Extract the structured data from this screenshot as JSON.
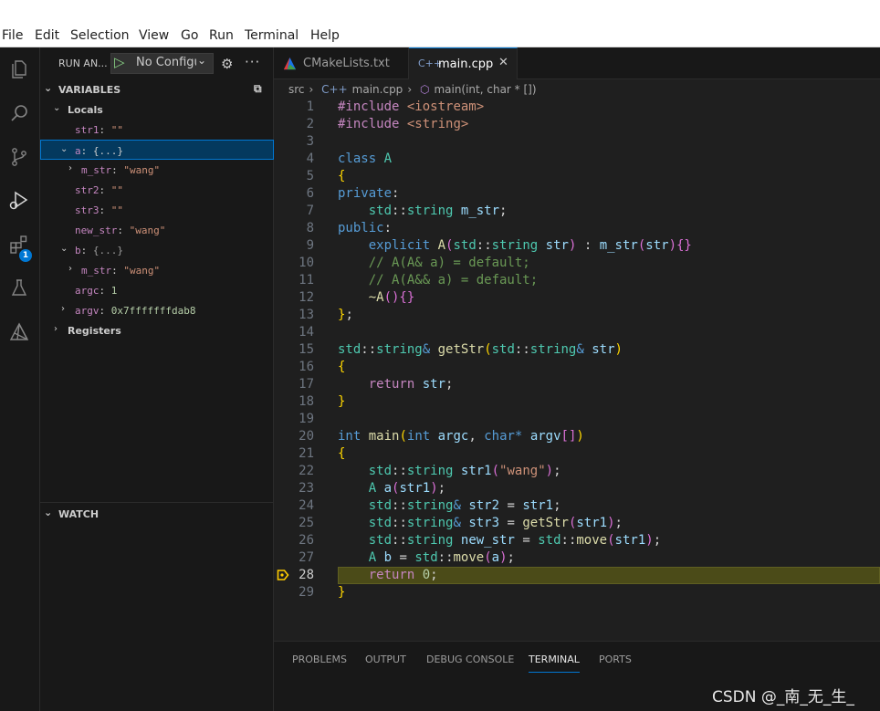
{
  "menu": [
    "File",
    "Edit",
    "Selection",
    "View",
    "Go",
    "Run",
    "Terminal",
    "Help"
  ],
  "activity_icons": [
    "explorer-icon",
    "search-icon",
    "source-control-icon",
    "run-debug-icon",
    "extensions-icon",
    "testing-icon",
    "cmake-icon"
  ],
  "debug_badge": "1",
  "run_bar": {
    "title": "RUN AN...",
    "config": "No Configu",
    "play_icon": "play-icon",
    "gear_icon": "gear-icon",
    "more_icon": "more-icon"
  },
  "variables": {
    "header": "VARIABLES",
    "locals_label": "Locals",
    "registers_label": "Registers",
    "rows": [
      {
        "name": "str1",
        "value": "\"\"",
        "kind": "str"
      },
      {
        "name": "a",
        "value": "{...}",
        "kind": "obj"
      },
      {
        "name": "m_str",
        "value": "\"wang\"",
        "kind": "str"
      },
      {
        "name": "str2",
        "value": "\"\"",
        "kind": "str"
      },
      {
        "name": "str3",
        "value": "\"\"",
        "kind": "str"
      },
      {
        "name": "new_str",
        "value": "\"wang\"",
        "kind": "str"
      },
      {
        "name": "b",
        "value": "{...}",
        "kind": "obj"
      },
      {
        "name": "m_str",
        "value": "\"wang\"",
        "kind": "str"
      },
      {
        "name": "argc",
        "value": "1",
        "kind": "num"
      },
      {
        "name": "argv",
        "value": "0x7fffffffdab8",
        "kind": "num"
      }
    ]
  },
  "watch": {
    "header": "WATCH"
  },
  "tabs": [
    {
      "label": "CMakeLists.txt",
      "active": false
    },
    {
      "label": "main.cpp",
      "active": true
    }
  ],
  "breadcrumb": {
    "folder": "src",
    "file": "main.cpp",
    "symbol": "main(int, char * [])"
  },
  "code": {
    "current_line": 28,
    "line_numbers": [
      "1",
      "2",
      "3",
      "4",
      "5",
      "6",
      "7",
      "8",
      "9",
      "10",
      "11",
      "12",
      "13",
      "14",
      "15",
      "16",
      "17",
      "18",
      "19",
      "20",
      "21",
      "22",
      "23",
      "24",
      "25",
      "26",
      "27",
      "28",
      "29"
    ]
  },
  "panel": {
    "tabs": [
      "PROBLEMS",
      "OUTPUT",
      "DEBUG CONSOLE",
      "TERMINAL",
      "PORTS"
    ],
    "active": "TERMINAL"
  },
  "watermark": "CSDN @_南_无_生_"
}
